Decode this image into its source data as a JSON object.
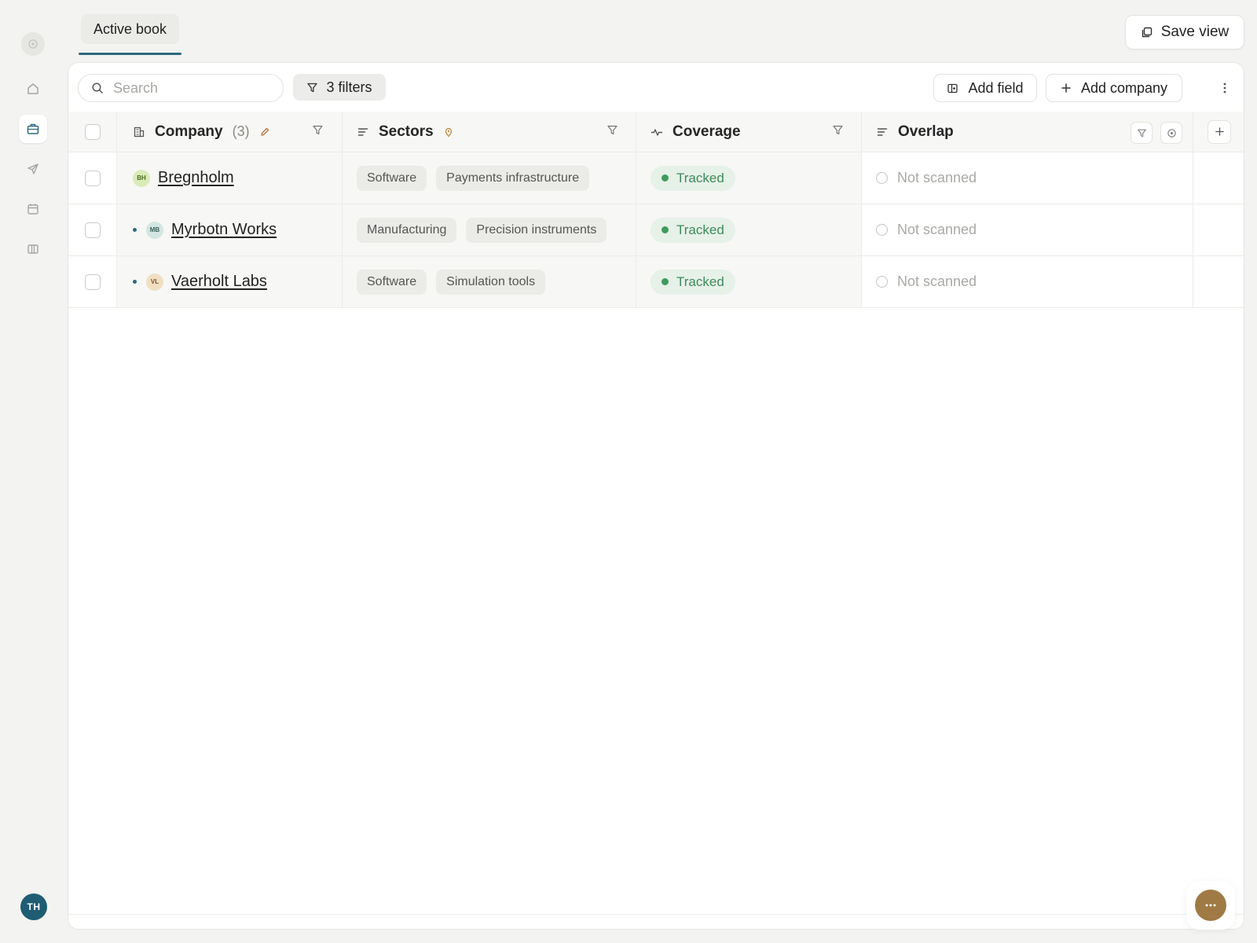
{
  "rail": {
    "avatar_initials": "TH",
    "items": [
      {
        "icon": "home-icon"
      },
      {
        "icon": "briefcase-icon",
        "active": true
      },
      {
        "icon": "send-icon"
      },
      {
        "icon": "calendar-icon"
      },
      {
        "icon": "board-icon"
      }
    ]
  },
  "header": {
    "active_tab": "Active book",
    "save_view": "Save view"
  },
  "toolbar": {
    "search_placeholder": "Search",
    "filters_label": "3 filters",
    "add_field": "Add field",
    "add_company": "Add company"
  },
  "table": {
    "columns": {
      "company": "Company",
      "company_count": "(3)",
      "sectors": "Sectors",
      "coverage": "Coverage",
      "overlap": "Overlap"
    },
    "rows": [
      {
        "initials": "BH",
        "name": "Bregnholm",
        "sectors": [
          "Software",
          "Payments infrastructure"
        ],
        "coverage": "Tracked",
        "overlap": "Not scanned",
        "badge_bg": "#d9ecb8",
        "badge_fg": "#4a6a1f",
        "has_dot": false
      },
      {
        "initials": "MB",
        "name": "Myrbotn Works",
        "sectors": [
          "Manufacturing",
          "Precision instruments"
        ],
        "coverage": "Tracked",
        "overlap": "Not scanned",
        "badge_bg": "#d3e6e2",
        "badge_fg": "#3c6159",
        "has_dot": true
      },
      {
        "initials": "VL",
        "name": "Vaerholt Labs",
        "sectors": [
          "Software",
          "Simulation tools"
        ],
        "coverage": "Tracked",
        "overlap": "Not scanned",
        "badge_bg": "#f1dfc4",
        "badge_fg": "#7a5526",
        "has_dot": true
      }
    ]
  },
  "colors": {
    "accent": "#2c6a80",
    "tracked_green": "#3f9a5e",
    "fab": "#a07a45"
  }
}
